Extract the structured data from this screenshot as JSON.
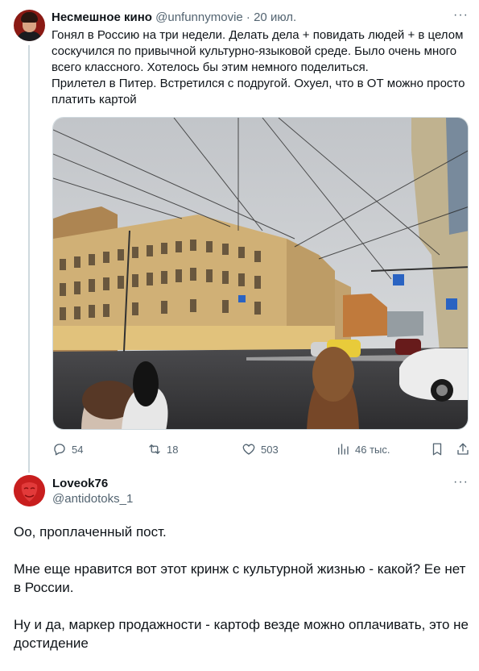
{
  "post1": {
    "author_name": "Несмешное кино",
    "handle": "@unfunnymovie",
    "separator": "·",
    "date": "20 июл.",
    "more": "···",
    "paragraphs": [
      "Гонял в Россию на три недели. Делать дела + повидать людей + в целом соскучился по привычной культурно-языковой среде. Было очень много всего классного. Хотелось бы этим немного поделиться.",
      "Прилетел в Питер. Встретился с подругой. Охуел, что в ОТ можно просто платить картой"
    ],
    "stats": {
      "replies": "54",
      "reposts": "18",
      "likes": "503",
      "views": "46 тыс."
    }
  },
  "post2": {
    "author_name": "Loveok76",
    "handle": "@antidotoks_1",
    "more": "···",
    "paragraphs": [
      "Оо, проплаченный пост.",
      "Мне еще нравится вот этот кринж с культурной жизнью - какой? Ее нет в России.",
      "Ну и да, маркер продажности - картоф везде можно оплачивать, это не достидение"
    ]
  },
  "icons": {
    "reply": "speech-bubble-icon",
    "repost": "repost-arrows-icon",
    "like": "heart-icon",
    "views": "bar-chart-icon",
    "bookmark": "bookmark-icon",
    "share": "share-upload-icon"
  },
  "colors": {
    "text": "#0f1419",
    "muted": "#536471",
    "divider": "#cfd9de",
    "avatar2_red": "#c81e1e"
  }
}
